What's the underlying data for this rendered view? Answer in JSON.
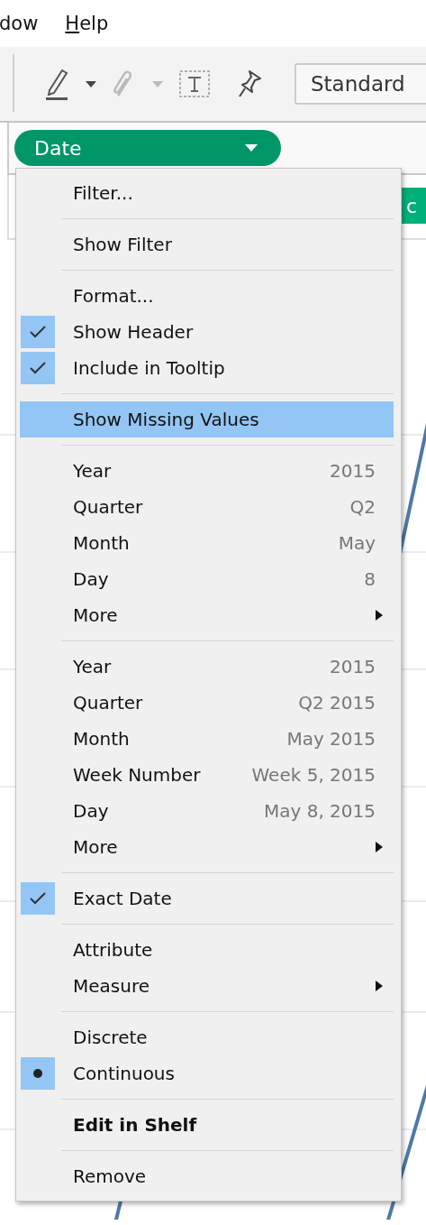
{
  "menubar": [
    {
      "label": "dow"
    },
    {
      "label": "Help"
    }
  ],
  "toolbar": {
    "style_select": "Standard"
  },
  "shelf": {
    "pill": "Date",
    "background_pill": "c"
  },
  "context_menu": {
    "groups": [
      [
        {
          "kind": "command",
          "label": "Filter...",
          "selected": false
        }
      ],
      [
        {
          "kind": "command",
          "label": "Show Filter",
          "selected": false
        }
      ],
      [
        {
          "kind": "command",
          "label": "Format...",
          "selected": false
        },
        {
          "kind": "check",
          "label": "Show Header",
          "checked": true,
          "selected": false
        },
        {
          "kind": "check",
          "label": "Include in Tooltip",
          "checked": true,
          "selected": false
        }
      ],
      [
        {
          "kind": "command",
          "label": "Show Missing Values",
          "selected": true
        }
      ],
      [
        {
          "kind": "command",
          "label": "Year",
          "value": "2015",
          "selected": false
        },
        {
          "kind": "command",
          "label": "Quarter",
          "value": "Q2",
          "selected": false
        },
        {
          "kind": "command",
          "label": "Month",
          "value": "May",
          "selected": false
        },
        {
          "kind": "command",
          "label": "Day",
          "value": "8",
          "selected": false
        },
        {
          "kind": "submenu",
          "label": "More",
          "selected": false
        }
      ],
      [
        {
          "kind": "command",
          "label": "Year",
          "value": "2015",
          "selected": false
        },
        {
          "kind": "command",
          "label": "Quarter",
          "value": "Q2 2015",
          "selected": false
        },
        {
          "kind": "command",
          "label": "Month",
          "value": "May 2015",
          "selected": false
        },
        {
          "kind": "command",
          "label": "Week Number",
          "value": "Week 5, 2015",
          "selected": false
        },
        {
          "kind": "command",
          "label": "Day",
          "value": "May 8, 2015",
          "selected": false
        },
        {
          "kind": "submenu",
          "label": "More",
          "selected": false
        }
      ],
      [
        {
          "kind": "check",
          "label": "Exact Date",
          "checked": true,
          "selected": false
        }
      ],
      [
        {
          "kind": "command",
          "label": "Attribute",
          "selected": false
        },
        {
          "kind": "submenu",
          "label": "Measure",
          "selected": false
        }
      ],
      [
        {
          "kind": "radio",
          "label": "Discrete",
          "checked": false,
          "selected": false
        },
        {
          "kind": "radio",
          "label": "Continuous",
          "checked": true,
          "selected": false
        }
      ],
      [
        {
          "kind": "command",
          "label": "Edit in Shelf",
          "bold": true,
          "selected": false
        }
      ],
      [
        {
          "kind": "command",
          "label": "Remove",
          "selected": false
        }
      ]
    ]
  }
}
